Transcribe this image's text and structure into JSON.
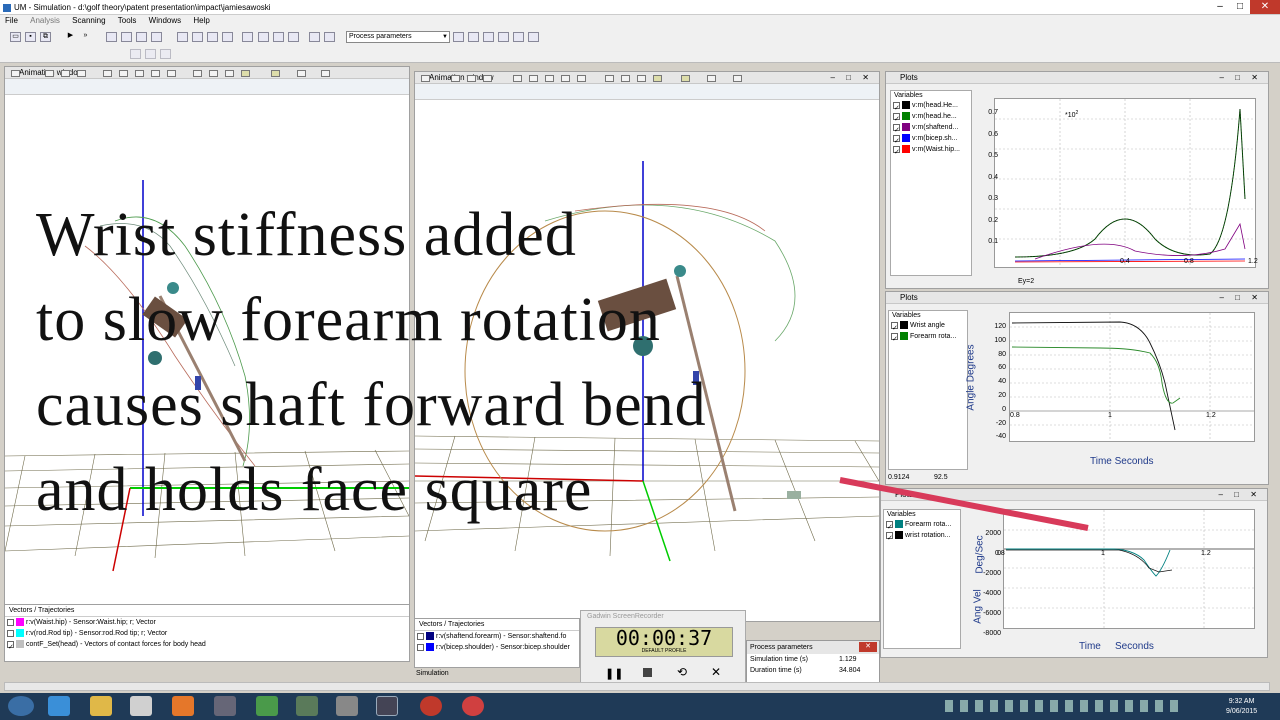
{
  "window": {
    "title": "UM - Simulation - d:\\golf theory\\patent presentation\\impact\\jamiesawoski"
  },
  "menu": [
    "File",
    "Analysis",
    "Scanning",
    "Tools",
    "Windows",
    "Help"
  ],
  "toolbar": {
    "process_select": "Process parameters"
  },
  "anim_left": {
    "title": "Animation window"
  },
  "anim_right": {
    "title": "Animation window"
  },
  "vectors_left": {
    "header": "Vectors / Trajectories",
    "rows": [
      {
        "text": "r:v(Waist.hip) - Sensor:Waist.hip; r; Vector",
        "color": "#ff00ff"
      },
      {
        "text": "r:v(rod.Rod tip) - Sensor:rod.Rod tip; r; Vector",
        "color": "#00ffff"
      },
      {
        "text": "contF_Set(head) - Vectors of contact forces for body head",
        "color": "#c0c0c0"
      }
    ]
  },
  "vectors_right": {
    "header": "Vectors / Trajectories",
    "rows": [
      {
        "text": "r:v(shaftend.forearm) - Sensor:shaftend.fo",
        "color": "#000080"
      },
      {
        "text": "r:v(bicep.shoulder) - Sensor:bicep.shoulder",
        "color": "#0000ff"
      }
    ]
  },
  "status_left": "Simulation",
  "plot1": {
    "title": "Plots",
    "variables_header": "Variables",
    "items": [
      {
        "label": "v:m(head.He...",
        "color": "#000000"
      },
      {
        "label": "v:m(head.he...",
        "color": "#008000"
      },
      {
        "label": "v:m(shaftend...",
        "color": "#800080"
      },
      {
        "label": "v:m(bicep.sh...",
        "color": "#0000ff"
      },
      {
        "label": "v:m(Waist.hip...",
        "color": "#ff0000"
      }
    ],
    "y_ticks": [
      "0.7",
      "0.6",
      "0.5",
      "0.4",
      "0.3",
      "0.2",
      "0.1"
    ],
    "x_ticks": [
      "0.4",
      "0.8",
      "1.2"
    ],
    "scale_label": "*10",
    "scale_exp": "2",
    "footer": "Ey=2"
  },
  "plot2": {
    "title": "Plots",
    "variables_header": "Variables",
    "items": [
      {
        "label": "Wrist angle",
        "color": "#000000"
      },
      {
        "label": "Forearm rota...",
        "color": "#008000"
      }
    ],
    "y_ticks": [
      "120",
      "100",
      "80",
      "60",
      "40",
      "20",
      "0",
      "-20",
      "-40"
    ],
    "x_ticks": [
      "0.8",
      "1",
      "1.2"
    ],
    "ylabel": "Angle Degrees",
    "xlabel": "Time Seconds",
    "status_left": "0.9124",
    "status_right": "92.5"
  },
  "plot3": {
    "title": "Plots",
    "variables_header": "Variables",
    "items": [
      {
        "label": "Forearm rota...",
        "color": "#008080"
      },
      {
        "label": "wrist rotation...",
        "color": "#000000"
      }
    ],
    "y_ticks": [
      "2000",
      "0",
      "-2000",
      "-4000",
      "-6000",
      "-8000"
    ],
    "x_ticks": [
      "0.8",
      "1",
      "1.2"
    ],
    "ylabel_top": "Deg/Sec",
    "ylabel_bottom": "Ang Vel",
    "xlabel_left": "Time",
    "xlabel_right": "Seconds"
  },
  "recorder": {
    "title": "Gadwin ScreenRecorder",
    "time": "00:00:37",
    "profile": "DEFAULT PROFILE"
  },
  "process_params": {
    "title": "Process parameters",
    "rows": [
      {
        "label": "Simulation time (s)",
        "value": "1.129"
      },
      {
        "label": "Duration time (s)",
        "value": "34.804"
      }
    ]
  },
  "overlay_lines": [
    "Wrist stiffness added",
    "to slow forearm rotation",
    "causes shaft forward bend",
    "and holds face square"
  ],
  "clock": {
    "time": "9:32 AM",
    "date": "9/06/2015"
  }
}
